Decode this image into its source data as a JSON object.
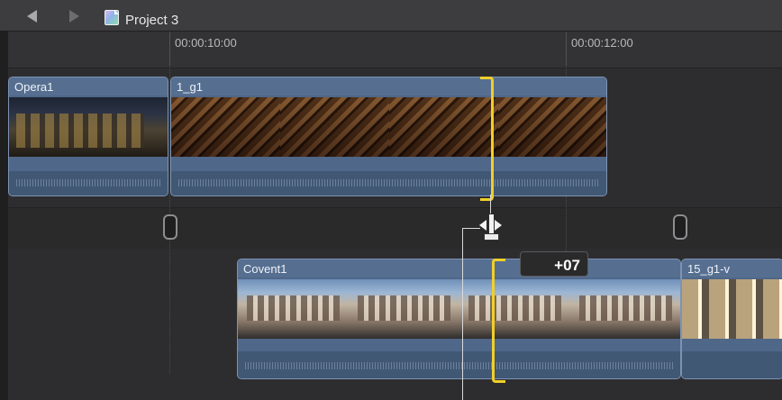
{
  "window": {
    "project_title": "Project 3"
  },
  "ruler": {
    "labels": [
      "00:00:10:00",
      "00:00:12:00"
    ]
  },
  "timeline": {
    "clips": [
      {
        "name": "Opera1"
      },
      {
        "name": "1_g1"
      },
      {
        "name": "Covent1"
      },
      {
        "name": "15_g1-v"
      }
    ],
    "trim_offset": "+07"
  },
  "colors": {
    "clip_fill": "#4f6788",
    "trim_highlight": "#f1cf28",
    "background": "#2b2b2c"
  },
  "icons": {
    "back": "back-arrow-icon",
    "forward": "forward-arrow-icon",
    "project": "project-icon",
    "cursor": "trim-cursor-icon"
  }
}
